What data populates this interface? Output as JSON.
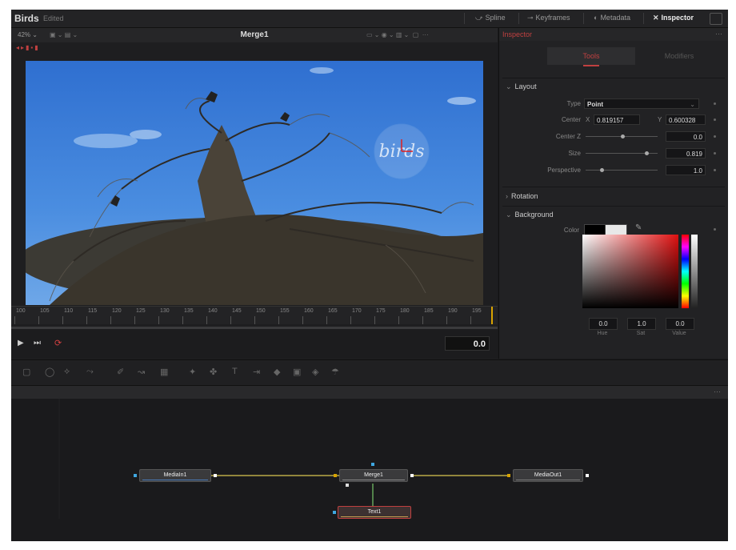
{
  "app": {
    "project": "Birds",
    "status": "Edited"
  },
  "topbar": {
    "spline": "Spline",
    "keyframes": "Keyframes",
    "metadata": "Metadata",
    "inspector": "Inspector"
  },
  "viewer": {
    "zoom": "42%",
    "title": "Merge1",
    "overlay_text": "birds",
    "timecode": "0.0",
    "ruler_labels": [
      "100",
      "105",
      "110",
      "115",
      "120",
      "125",
      "130",
      "135",
      "140",
      "145",
      "150",
      "155",
      "160",
      "165",
      "170",
      "175",
      "180",
      "185",
      "190",
      "195"
    ]
  },
  "inspector": {
    "header": "Inspector",
    "tabs": {
      "tools": "Tools",
      "modifiers": "Modifiers"
    },
    "layout": {
      "section": "Layout",
      "type_label": "Type",
      "type_value": "Point",
      "center_label": "Center",
      "center_x_label": "X",
      "center_x": "0.819157",
      "center_y_label": "Y",
      "center_y": "0.600328",
      "centerz_label": "Center Z",
      "centerz": "0.0",
      "size_label": "Size",
      "size": "0.819",
      "perspective_label": "Perspective",
      "perspective": "1.0"
    },
    "rotation": {
      "section": "Rotation"
    },
    "background": {
      "section": "Background",
      "color_label": "Color",
      "hue": "0.0",
      "sat": "1.0",
      "value": "0.0",
      "hue_label": "Hue",
      "sat_label": "Sat",
      "value_label": "Value"
    }
  },
  "nodes": {
    "media_in": "MediaIn1",
    "merge": "Merge1",
    "media_out": "MediaOut1",
    "text": "Text1"
  },
  "colors": {
    "accent": "#c04040",
    "playhead": "#d9a300",
    "link": "#d9c850"
  }
}
